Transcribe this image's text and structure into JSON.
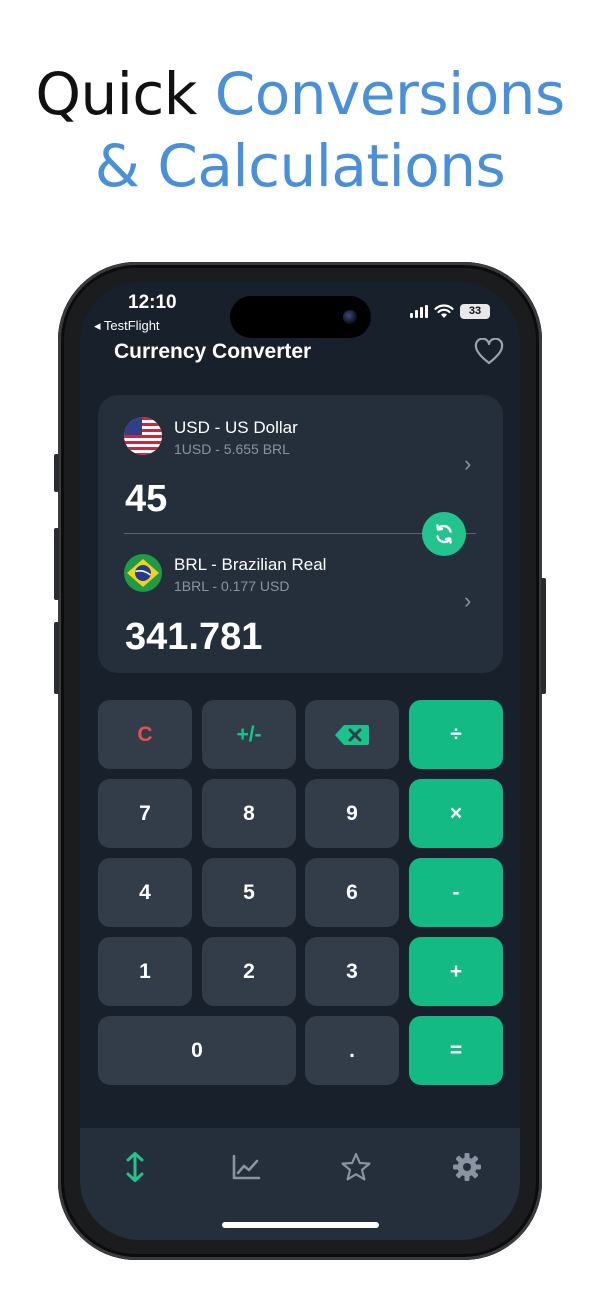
{
  "headline": {
    "line1_plain": "Quick",
    "line1_accent": "Conversions",
    "line2_accent": "& Calculations"
  },
  "status_bar": {
    "time": "12:10",
    "back_app": "◂ TestFlight",
    "battery": "33"
  },
  "app": {
    "title": "Currency Converter"
  },
  "converter": {
    "from": {
      "name": "USD - US Dollar",
      "rate": "1USD - 5.655 BRL",
      "amount": "45"
    },
    "to": {
      "name": "BRL - Brazilian Real",
      "rate": "1BRL - 0.177 USD",
      "amount": "341.781"
    }
  },
  "keypad": {
    "clear": "C",
    "sign": "+/-",
    "divide": "÷",
    "multiply": "×",
    "minus": "-",
    "plus": "+",
    "equals": "=",
    "seven": "7",
    "eight": "8",
    "nine": "9",
    "four": "4",
    "five": "5",
    "six": "6",
    "one": "1",
    "two": "2",
    "three": "3",
    "zero": "0",
    "dot": "."
  },
  "colors": {
    "accent": "#13ba83",
    "background": "#18202c",
    "card": "#252e3b",
    "headline_accent": "#4a90d9"
  },
  "icons": {
    "favorite": "heart-icon",
    "swap": "swap-icon",
    "backspace": "backspace-icon",
    "tab_convert": "swap-vertical-icon",
    "tab_chart": "chart-icon",
    "tab_favorites": "star-icon",
    "tab_settings": "gear-icon"
  }
}
